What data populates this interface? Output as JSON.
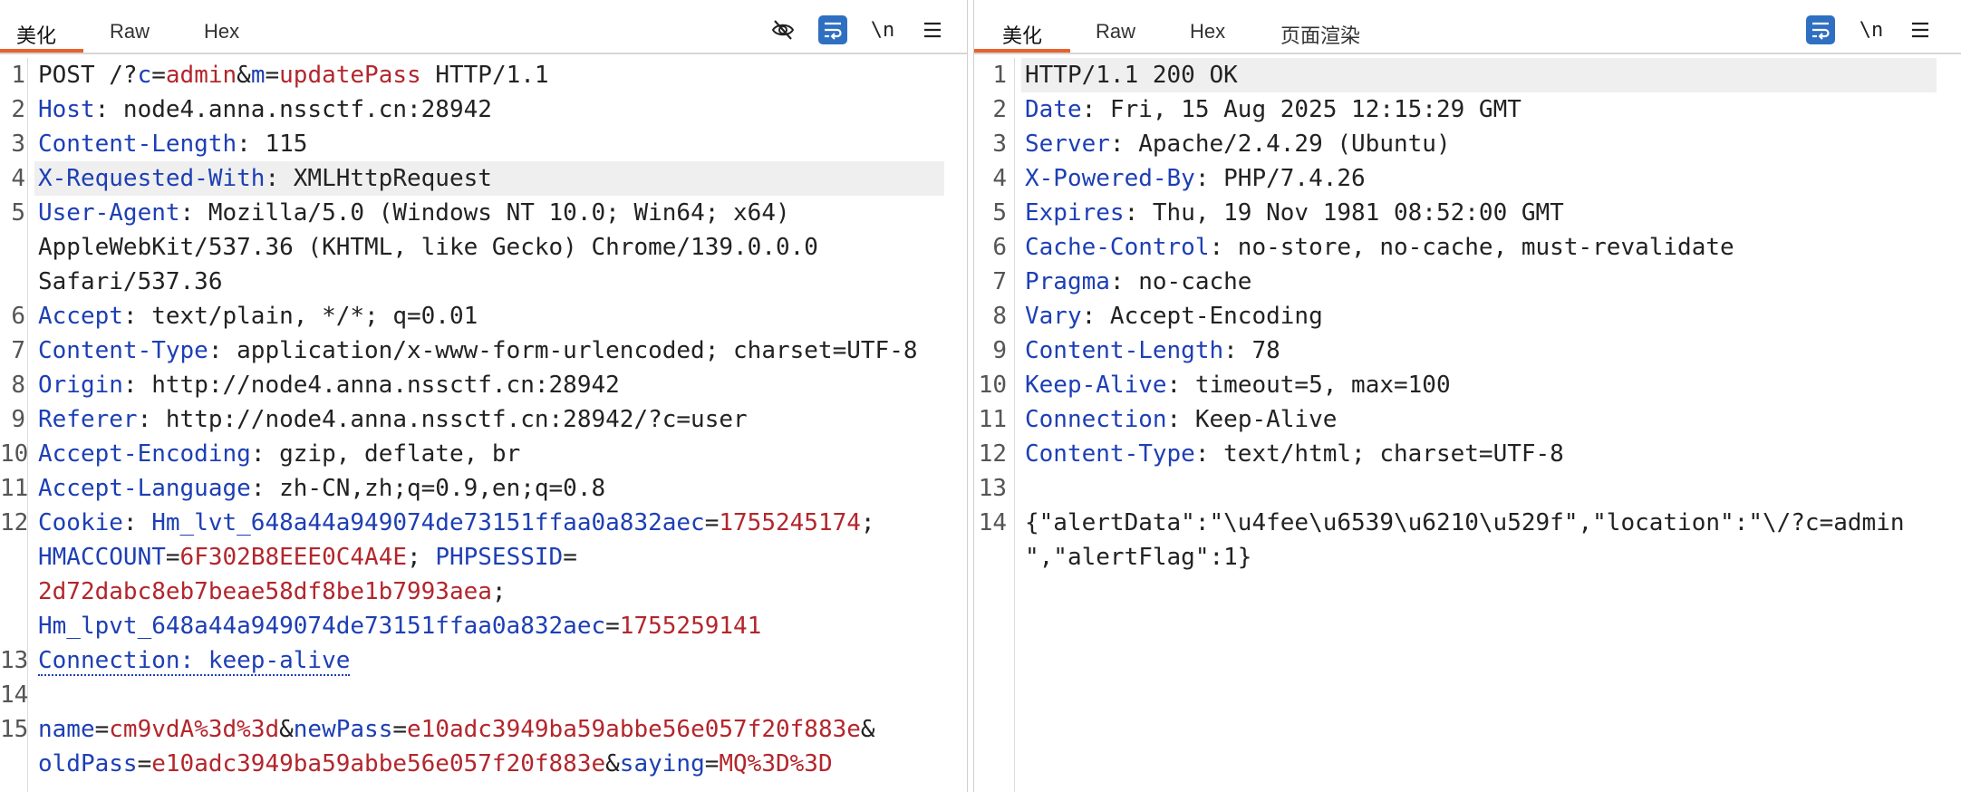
{
  "request": {
    "tabs": [
      {
        "label": "美化"
      },
      {
        "label": "Raw"
      },
      {
        "label": "Hex"
      }
    ],
    "tools": {
      "eye_icon": "eye-off-icon",
      "wrap_icon": "wrap-icon",
      "newline_label": "\\n",
      "menu_icon": "menu-icon"
    },
    "lines": [
      {
        "num": "1",
        "segs": [
          {
            "t": "POST /?",
            "c": "v"
          },
          {
            "t": "c",
            "c": "n"
          },
          {
            "t": "=",
            "c": "v"
          },
          {
            "t": "admin",
            "c": "val"
          },
          {
            "t": "&",
            "c": "v"
          },
          {
            "t": "m",
            "c": "n"
          },
          {
            "t": "=",
            "c": "v"
          },
          {
            "t": "updatePass",
            "c": "val"
          },
          {
            "t": " HTTP/1.1",
            "c": "v"
          }
        ]
      },
      {
        "num": "2",
        "segs": [
          {
            "t": "Host",
            "c": "k"
          },
          {
            "t": ": node4.anna.nssctf.cn:28942",
            "c": "v"
          }
        ]
      },
      {
        "num": "3",
        "segs": [
          {
            "t": "Content-Length",
            "c": "k"
          },
          {
            "t": ": 115",
            "c": "v"
          }
        ]
      },
      {
        "num": "4",
        "highlight": true,
        "segs": [
          {
            "t": "X-Requested-With",
            "c": "k"
          },
          {
            "t": ": XMLHttpRequest",
            "c": "v"
          }
        ]
      },
      {
        "num": "5",
        "segs": [
          {
            "t": "User-Agent",
            "c": "k"
          },
          {
            "t": ": Mozilla/5.0 (Windows NT 10.0; Win64; x64)",
            "c": "v"
          }
        ]
      },
      {
        "num": "",
        "segs": [
          {
            "t": "AppleWebKit/537.36 (KHTML, like Gecko) Chrome/139.0.0.0",
            "c": "v"
          }
        ]
      },
      {
        "num": "",
        "segs": [
          {
            "t": "Safari/537.36",
            "c": "v"
          }
        ]
      },
      {
        "num": "6",
        "segs": [
          {
            "t": "Accept",
            "c": "k"
          },
          {
            "t": ": text/plain, */*; q=0.01",
            "c": "v"
          }
        ]
      },
      {
        "num": "7",
        "segs": [
          {
            "t": "Content-Type",
            "c": "k"
          },
          {
            "t": ": application/x-www-form-urlencoded; charset=UTF-8",
            "c": "v"
          }
        ]
      },
      {
        "num": "8",
        "segs": [
          {
            "t": "Origin",
            "c": "k"
          },
          {
            "t": ": http://node4.anna.nssctf.cn:28942",
            "c": "v"
          }
        ]
      },
      {
        "num": "9",
        "segs": [
          {
            "t": "Referer",
            "c": "k"
          },
          {
            "t": ": http://node4.anna.nssctf.cn:28942/?c=user",
            "c": "v"
          }
        ]
      },
      {
        "num": "10",
        "segs": [
          {
            "t": "Accept-Encoding",
            "c": "k"
          },
          {
            "t": ": gzip, deflate, br",
            "c": "v"
          }
        ]
      },
      {
        "num": "11",
        "segs": [
          {
            "t": "Accept-Language",
            "c": "k"
          },
          {
            "t": ": zh-CN,zh;q=0.9,en;q=0.8",
            "c": "v"
          }
        ]
      },
      {
        "num": "12",
        "segs": [
          {
            "t": "Cookie",
            "c": "k"
          },
          {
            "t": ": ",
            "c": "v"
          },
          {
            "t": "Hm_lvt_648a44a949074de73151ffaa0a832aec",
            "c": "n"
          },
          {
            "t": "=",
            "c": "v"
          },
          {
            "t": "1755245174",
            "c": "val"
          },
          {
            "t": ";",
            "c": "v"
          }
        ]
      },
      {
        "num": "",
        "segs": [
          {
            "t": "HMACCOUNT",
            "c": "n"
          },
          {
            "t": "=",
            "c": "v"
          },
          {
            "t": "6F302B8EEE0C4A4E",
            "c": "val"
          },
          {
            "t": "; ",
            "c": "v"
          },
          {
            "t": "PHPSESSID",
            "c": "n"
          },
          {
            "t": "=",
            "c": "v"
          }
        ]
      },
      {
        "num": "",
        "segs": [
          {
            "t": "2d72dabc8eb7beae58df8be1b7993aea",
            "c": "val"
          },
          {
            "t": ";",
            "c": "v"
          }
        ]
      },
      {
        "num": "",
        "segs": [
          {
            "t": "Hm_lpvt_648a44a949074de73151ffaa0a832aec",
            "c": "n"
          },
          {
            "t": "=",
            "c": "v"
          },
          {
            "t": "1755259141",
            "c": "val"
          }
        ]
      },
      {
        "num": "13",
        "segs": [
          {
            "t": "Connection: keep-alive",
            "c": "k dotted"
          }
        ]
      },
      {
        "num": "14",
        "segs": []
      },
      {
        "num": "15",
        "segs": [
          {
            "t": "name",
            "c": "n"
          },
          {
            "t": "=",
            "c": "v"
          },
          {
            "t": "cm9vdA%3d%3d",
            "c": "val"
          },
          {
            "t": "&",
            "c": "v"
          },
          {
            "t": "newPass",
            "c": "n"
          },
          {
            "t": "=",
            "c": "v"
          },
          {
            "t": "e10adc3949ba59abbe56e057f20f883e",
            "c": "val"
          },
          {
            "t": "&",
            "c": "v"
          }
        ]
      },
      {
        "num": "",
        "segs": [
          {
            "t": "oldPass",
            "c": "n"
          },
          {
            "t": "=",
            "c": "v"
          },
          {
            "t": "e10adc3949ba59abbe56e057f20f883e",
            "c": "val"
          },
          {
            "t": "&",
            "c": "v"
          },
          {
            "t": "saying",
            "c": "n"
          },
          {
            "t": "=",
            "c": "v"
          },
          {
            "t": "MQ%3D%3D",
            "c": "val"
          }
        ]
      }
    ]
  },
  "response": {
    "tabs": [
      {
        "label": "美化"
      },
      {
        "label": "Raw"
      },
      {
        "label": "Hex"
      },
      {
        "label": "页面渲染"
      }
    ],
    "tools": {
      "wrap_icon": "wrap-icon",
      "newline_label": "\\n",
      "menu_icon": "menu-icon"
    },
    "lines": [
      {
        "num": "1",
        "highlight": true,
        "segs": [
          {
            "t": "HTTP/1.1 200 OK",
            "c": "v"
          }
        ]
      },
      {
        "num": "2",
        "segs": [
          {
            "t": "Date",
            "c": "k"
          },
          {
            "t": ": Fri, 15 Aug 2025 12:15:29 GMT",
            "c": "v"
          }
        ]
      },
      {
        "num": "3",
        "segs": [
          {
            "t": "Server",
            "c": "k"
          },
          {
            "t": ": Apache/2.4.29 (Ubuntu)",
            "c": "v"
          }
        ]
      },
      {
        "num": "4",
        "segs": [
          {
            "t": "X-Powered-By",
            "c": "k"
          },
          {
            "t": ": PHP/7.4.26",
            "c": "v"
          }
        ]
      },
      {
        "num": "5",
        "segs": [
          {
            "t": "Expires",
            "c": "k"
          },
          {
            "t": ": Thu, 19 Nov 1981 08:52:00 GMT",
            "c": "v"
          }
        ]
      },
      {
        "num": "6",
        "segs": [
          {
            "t": "Cache-Control",
            "c": "k"
          },
          {
            "t": ": no-store, no-cache, must-revalidate",
            "c": "v"
          }
        ]
      },
      {
        "num": "7",
        "segs": [
          {
            "t": "Pragma",
            "c": "k"
          },
          {
            "t": ": no-cache",
            "c": "v"
          }
        ]
      },
      {
        "num": "8",
        "segs": [
          {
            "t": "Vary",
            "c": "k"
          },
          {
            "t": ": Accept-Encoding",
            "c": "v"
          }
        ]
      },
      {
        "num": "9",
        "segs": [
          {
            "t": "Content-Length",
            "c": "k"
          },
          {
            "t": ": 78",
            "c": "v"
          }
        ]
      },
      {
        "num": "10",
        "segs": [
          {
            "t": "Keep-Alive",
            "c": "k"
          },
          {
            "t": ": timeout=5, max=100",
            "c": "v"
          }
        ]
      },
      {
        "num": "11",
        "segs": [
          {
            "t": "Connection",
            "c": "k"
          },
          {
            "t": ": Keep-Alive",
            "c": "v"
          }
        ]
      },
      {
        "num": "12",
        "segs": [
          {
            "t": "Content-Type",
            "c": "k"
          },
          {
            "t": ": text/html; charset=UTF-8",
            "c": "v"
          }
        ]
      },
      {
        "num": "13",
        "segs": []
      },
      {
        "num": "14",
        "segs": [
          {
            "t": "{\"alertData\":\"\\u4fee\\u6539\\u6210\\u529f\",\"location\":\"\\/?c=admin",
            "c": "v"
          }
        ]
      },
      {
        "num": "",
        "segs": [
          {
            "t": "\",\"alertFlag\":1}",
            "c": "v"
          }
        ]
      }
    ]
  },
  "colors": {
    "accent": "#e8622a",
    "key": "#1d3fb5",
    "value": "#b3262c",
    "toggle": "#2f6fc2"
  }
}
